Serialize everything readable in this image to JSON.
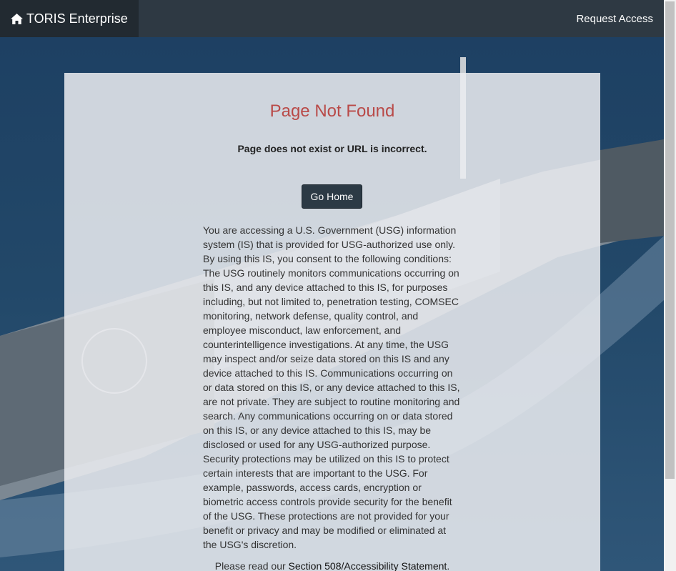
{
  "navbar": {
    "brand_label": "TORIS Enterprise",
    "brand_icon": "home-icon",
    "request_access_label": "Request Access"
  },
  "main": {
    "title": "Page Not Found",
    "subtitle": "Page does not exist or URL is incorrect.",
    "go_home_label": "Go Home",
    "notice": "You are accessing a U.S. Government (USG) information system (IS) that is provided for USG-authorized use only. By using this IS, you consent to the following conditions: The USG routinely monitors communications occurring on this IS, and any device attached to this IS, for purposes including, but not limited to, penetration testing, COMSEC monitoring, network defense, quality control, and employee misconduct, law enforcement, and counterintelligence investigations. At any time, the USG may inspect and/or seize data stored on this IS and any device attached to this IS. Communications occurring on or data stored on this IS, or any device attached to this IS, are not private. They are subject to routine monitoring and search. Any communications occurring on or data stored on this IS, or any device attached to this IS, may be disclosed or used for any USG-authorized purpose. Security protections may be utilized on this IS to protect certain interests that are important to the USG. For example, passwords, access cards, encryption or biometric access controls provide security for the benefit of the USG. These protections are not provided for your benefit or privacy and may be modified or eliminated at the USG's discretion.",
    "footer_prefix": "Please read our ",
    "footer_link": "Section 508/Accessibility Statement",
    "footer_suffix": "."
  },
  "colors": {
    "title": "#b94a48",
    "navbar": "#2e3943",
    "brand_bg": "#222a31",
    "button": "#2c3a45"
  }
}
